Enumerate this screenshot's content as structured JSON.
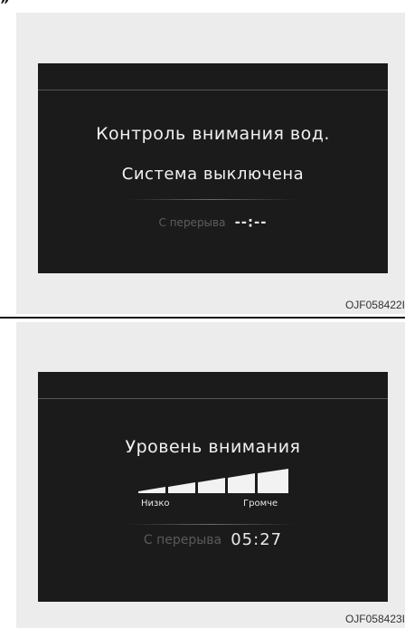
{
  "header_mark": "”",
  "panels": [
    {
      "title": "Контроль внимания вод.",
      "status": "Система выключена",
      "break_label": "С перерыва",
      "break_value": "--:--",
      "figure_code": "OJF058422I"
    },
    {
      "title": "Уровень внимания",
      "level": {
        "low_label": "Низко",
        "high_label": "Громче",
        "segments_filled": 5,
        "segments_total": 5
      },
      "break_label": "С перерыва",
      "break_value": "05:27",
      "figure_code": "OJF058423I"
    }
  ],
  "colors": {
    "panel_background": "#ececec",
    "screen_background": "#1b1b1b",
    "screen_text": "#f2f2f2",
    "muted_text": "#5e5e5e"
  }
}
